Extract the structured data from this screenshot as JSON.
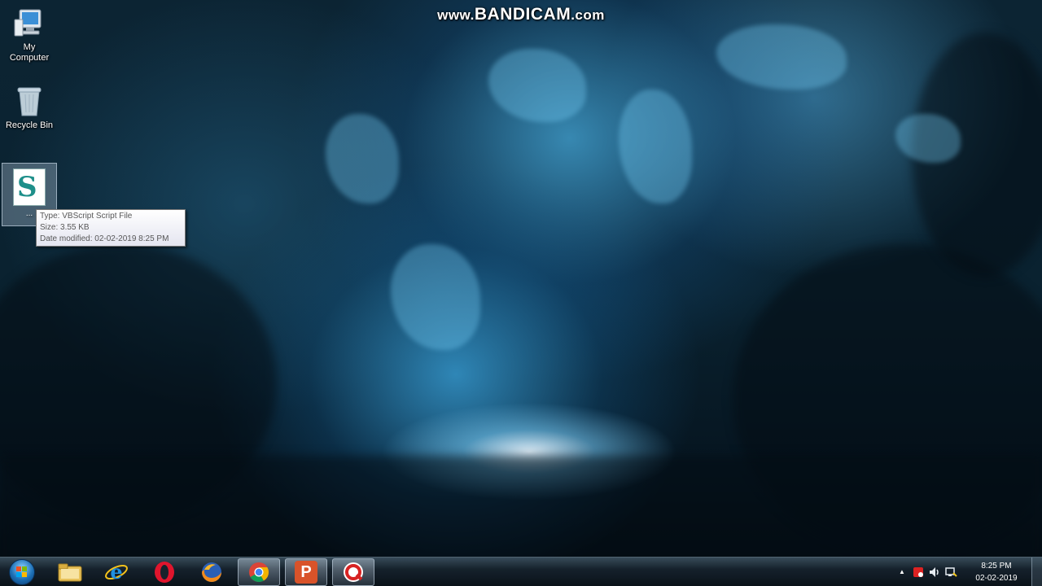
{
  "watermark": {
    "pre": "www.",
    "brand": "BANDICAM",
    "post": ".com"
  },
  "desktop_icons": [
    {
      "name": "my-computer",
      "label_line1": "My",
      "label_line2": "Computer",
      "icon": "computer-icon"
    },
    {
      "name": "recycle-bin",
      "label_line1": "Recycle Bin",
      "icon": "recycle-bin-icon"
    }
  ],
  "script_icon": {
    "label": "...",
    "icon": "vbscript-file-icon"
  },
  "tooltip": {
    "type": "Type: VBScript Script File",
    "size": "Size: 3.55 KB",
    "modified": "Date modified: 02-02-2019 8:25 PM"
  },
  "taskbar": {
    "pinned": [
      {
        "name": "file-explorer",
        "icon": "folder-icon"
      },
      {
        "name": "internet-explorer",
        "icon": "internet-explorer-icon"
      },
      {
        "name": "opera",
        "icon": "opera-icon"
      },
      {
        "name": "firefox",
        "icon": "firefox-icon"
      },
      {
        "name": "chrome",
        "icon": "chrome-icon"
      },
      {
        "name": "pp-app",
        "icon": "p-app-icon",
        "glyph": "P"
      },
      {
        "name": "bandicam",
        "icon": "bandicam-icon"
      }
    ],
    "clock": {
      "time": "8:25 PM",
      "date": "02-02-2019"
    },
    "tray_arrow": "▲"
  },
  "colors": {
    "accent": "#1d6fb5",
    "taskbar": "#16222c"
  }
}
